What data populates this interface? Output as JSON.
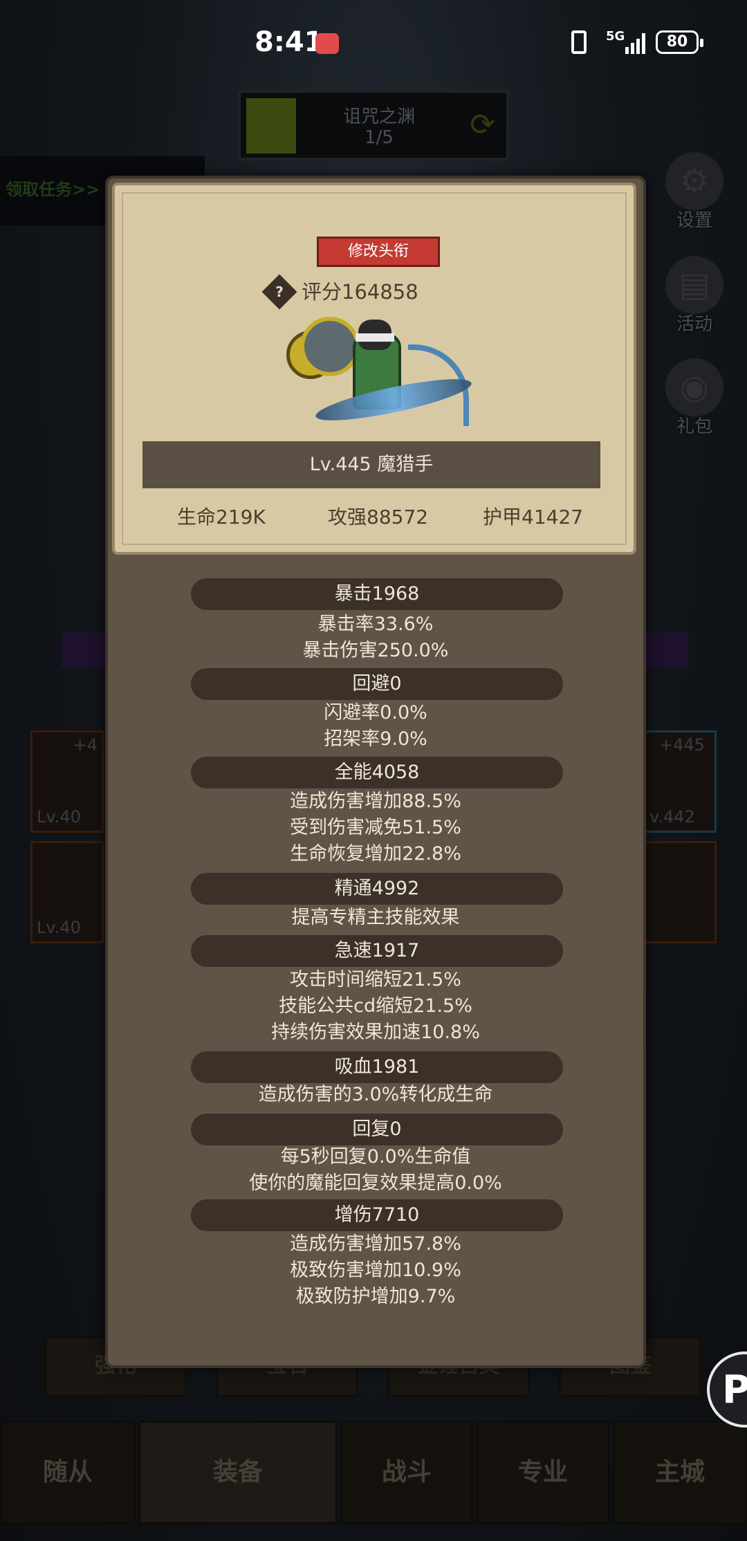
{
  "status_bar": {
    "time": "8:41",
    "network": "5G",
    "battery": "80"
  },
  "background": {
    "dungeon": {
      "name": "诅咒之渊",
      "progress": "1/5"
    },
    "quest_link": "领取任务>>",
    "side_buttons": [
      {
        "label": "设置",
        "icon": "gear-icon"
      },
      {
        "label": "活动",
        "icon": "scroll-icon"
      },
      {
        "label": "礼包",
        "icon": "gift-icon"
      }
    ],
    "slots": [
      {
        "plus": "+4",
        "level": "Lv.40"
      },
      {
        "plus": "",
        "level": "Lv.40"
      },
      {
        "plus": "+445",
        "level": "v.442"
      },
      {
        "plus": "",
        "level": ""
      }
    ],
    "lower_tabs": [
      "强化",
      "宝石",
      "金锤古奥",
      "图鉴"
    ],
    "nav": [
      "随从",
      "装备",
      "战斗",
      "专业",
      "主城"
    ],
    "float_button": "P"
  },
  "modal": {
    "edit_title_label": "修改头衔",
    "score_label": "评分164858",
    "help_icon": "?",
    "hero_name": "Lv.445 魔猎手",
    "base_stats": {
      "hp": "生命219K",
      "attack": "攻强88572",
      "armor": "护甲41427"
    },
    "stats": [
      {
        "title": "暴击1968",
        "lines": [
          "暴击率33.6%",
          "暴击伤害250.0%"
        ]
      },
      {
        "title": "回避0",
        "lines": [
          "闪避率0.0%",
          "招架率9.0%"
        ]
      },
      {
        "title": "全能4058",
        "lines": [
          "造成伤害增加88.5%",
          "受到伤害减免51.5%",
          "生命恢复增加22.8%"
        ]
      },
      {
        "title": "精通4992",
        "lines": [
          "提高专精主技能效果"
        ]
      },
      {
        "title": "急速1917",
        "lines": [
          "攻击时间缩短21.5%",
          "技能公共cd缩短21.5%",
          "持续伤害效果加速10.8%"
        ]
      },
      {
        "title": "吸血1981",
        "lines": [
          "造成伤害的3.0%转化成生命"
        ]
      },
      {
        "title": "回复0",
        "lines": [
          "每5秒回复0.0%生命值",
          "使你的魔能回复效果提高0.0%"
        ]
      },
      {
        "title": "增伤7710",
        "lines": [
          "造成伤害增加57.8%",
          "极致伤害增加10.9%",
          "极致防护增加9.7%"
        ]
      }
    ]
  }
}
